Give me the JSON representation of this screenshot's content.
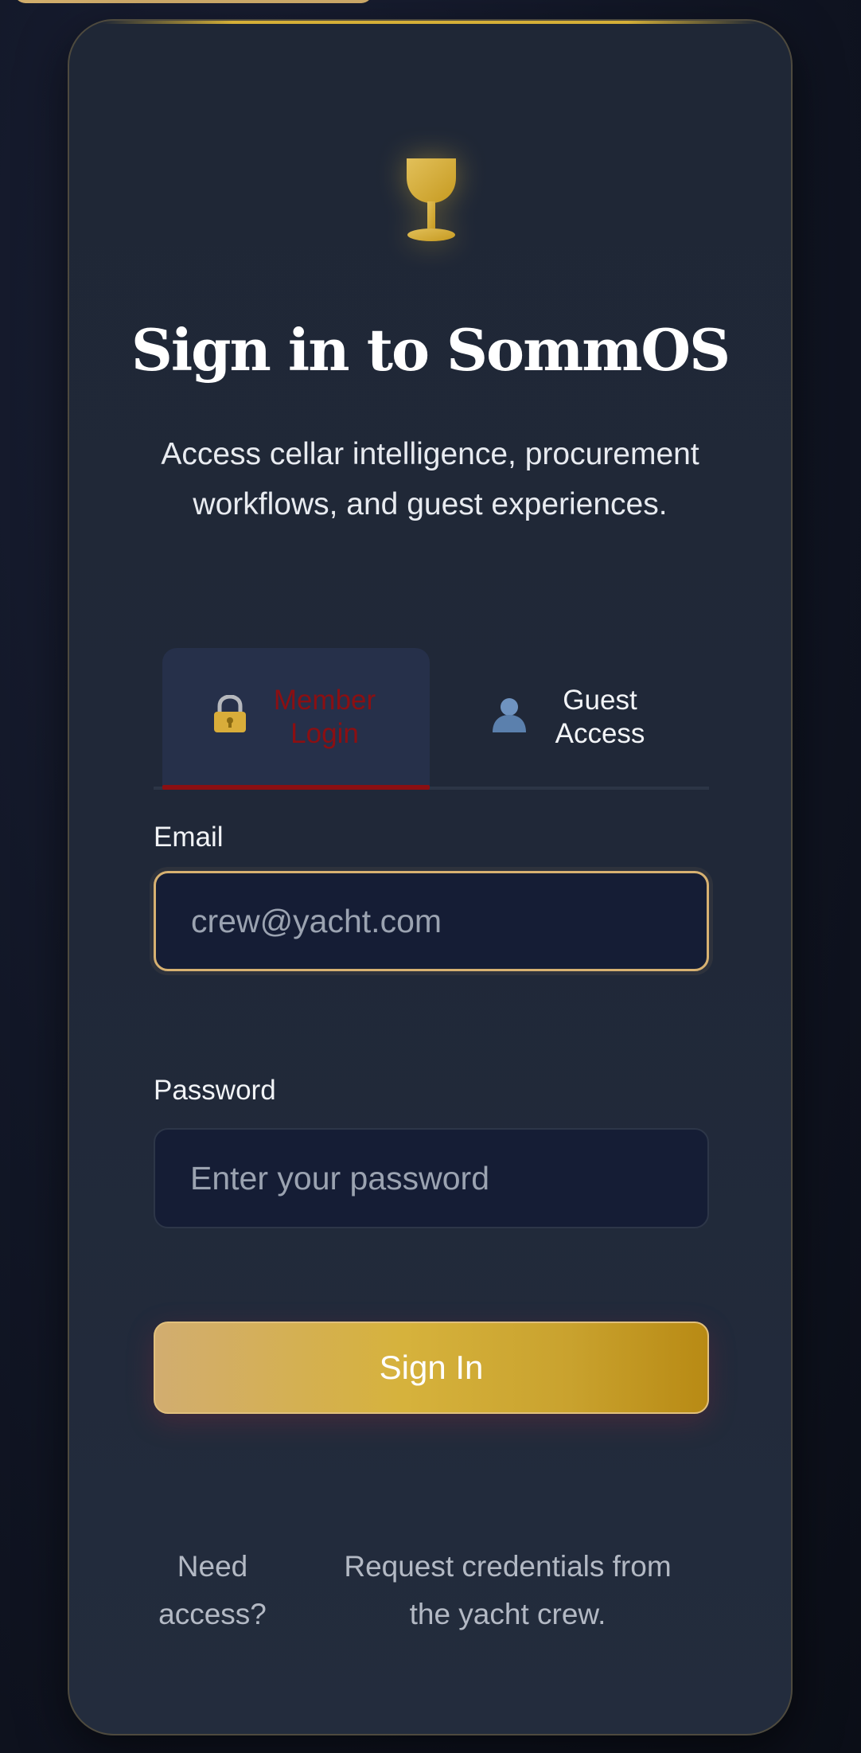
{
  "header": {
    "title": "Sign in to SommOS",
    "subtitle": "Access cellar intelligence, procurement workflows, and guest experiences."
  },
  "logo": {
    "icon": "wine-glass-icon",
    "color": "#d4af37"
  },
  "tabs": [
    {
      "icon": "lock-icon",
      "label": "Member Login",
      "active": true,
      "color": "#8b0f12"
    },
    {
      "icon": "person-icon",
      "label": "Guest Access",
      "active": false,
      "color": "#f2f4f7"
    }
  ],
  "form": {
    "email": {
      "label": "Email",
      "value": "",
      "placeholder": "crew@yacht.com"
    },
    "password": {
      "label": "Password",
      "value": "",
      "placeholder": "Enter your password"
    },
    "submit_label": "Sign In"
  },
  "footer": {
    "prompt": "Need access?",
    "message": "Request credentials from the yacht crew."
  },
  "colors": {
    "accent_gold": "#d4af37",
    "active_tab": "#8b0f12",
    "background": "#121727",
    "card": "#202838"
  }
}
